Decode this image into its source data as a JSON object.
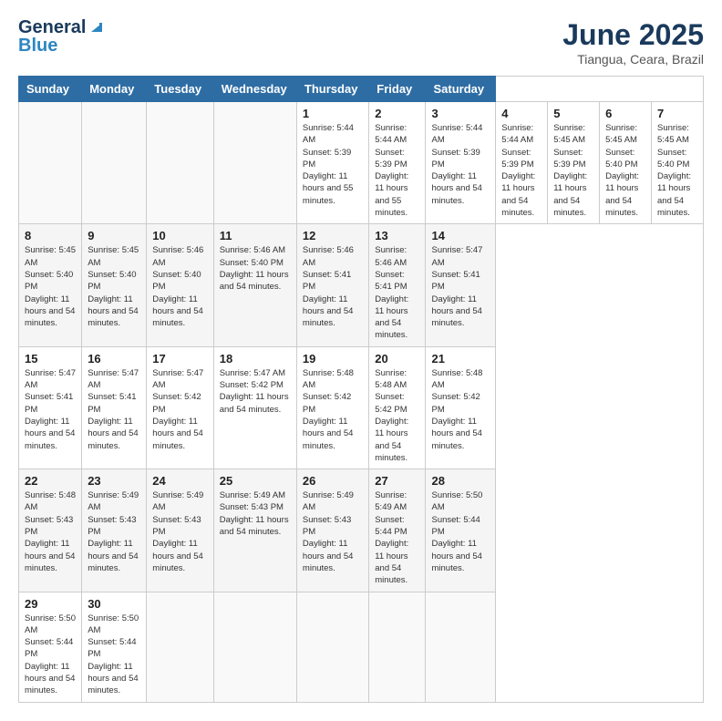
{
  "header": {
    "logo_general": "General",
    "logo_blue": "Blue",
    "month_title": "June 2025",
    "location": "Tiangua, Ceara, Brazil"
  },
  "calendar": {
    "days_of_week": [
      "Sunday",
      "Monday",
      "Tuesday",
      "Wednesday",
      "Thursday",
      "Friday",
      "Saturday"
    ],
    "weeks": [
      [
        null,
        null,
        null,
        null,
        {
          "day": "1",
          "sunrise": "5:44 AM",
          "sunset": "5:39 PM",
          "daylight": "11 hours and 55 minutes."
        },
        {
          "day": "2",
          "sunrise": "5:44 AM",
          "sunset": "5:39 PM",
          "daylight": "11 hours and 55 minutes."
        },
        {
          "day": "3",
          "sunrise": "5:44 AM",
          "sunset": "5:39 PM",
          "daylight": "11 hours and 54 minutes."
        },
        {
          "day": "4",
          "sunrise": "5:44 AM",
          "sunset": "5:39 PM",
          "daylight": "11 hours and 54 minutes."
        },
        {
          "day": "5",
          "sunrise": "5:45 AM",
          "sunset": "5:39 PM",
          "daylight": "11 hours and 54 minutes."
        },
        {
          "day": "6",
          "sunrise": "5:45 AM",
          "sunset": "5:40 PM",
          "daylight": "11 hours and 54 minutes."
        },
        {
          "day": "7",
          "sunrise": "5:45 AM",
          "sunset": "5:40 PM",
          "daylight": "11 hours and 54 minutes."
        }
      ],
      [
        {
          "day": "8",
          "sunrise": "5:45 AM",
          "sunset": "5:40 PM",
          "daylight": "11 hours and 54 minutes."
        },
        {
          "day": "9",
          "sunrise": "5:45 AM",
          "sunset": "5:40 PM",
          "daylight": "11 hours and 54 minutes."
        },
        {
          "day": "10",
          "sunrise": "5:46 AM",
          "sunset": "5:40 PM",
          "daylight": "11 hours and 54 minutes."
        },
        {
          "day": "11",
          "sunrise": "5:46 AM",
          "sunset": "5:40 PM",
          "daylight": "11 hours and 54 minutes."
        },
        {
          "day": "12",
          "sunrise": "5:46 AM",
          "sunset": "5:41 PM",
          "daylight": "11 hours and 54 minutes."
        },
        {
          "day": "13",
          "sunrise": "5:46 AM",
          "sunset": "5:41 PM",
          "daylight": "11 hours and 54 minutes."
        },
        {
          "day": "14",
          "sunrise": "5:47 AM",
          "sunset": "5:41 PM",
          "daylight": "11 hours and 54 minutes."
        }
      ],
      [
        {
          "day": "15",
          "sunrise": "5:47 AM",
          "sunset": "5:41 PM",
          "daylight": "11 hours and 54 minutes."
        },
        {
          "day": "16",
          "sunrise": "5:47 AM",
          "sunset": "5:41 PM",
          "daylight": "11 hours and 54 minutes."
        },
        {
          "day": "17",
          "sunrise": "5:47 AM",
          "sunset": "5:42 PM",
          "daylight": "11 hours and 54 minutes."
        },
        {
          "day": "18",
          "sunrise": "5:47 AM",
          "sunset": "5:42 PM",
          "daylight": "11 hours and 54 minutes."
        },
        {
          "day": "19",
          "sunrise": "5:48 AM",
          "sunset": "5:42 PM",
          "daylight": "11 hours and 54 minutes."
        },
        {
          "day": "20",
          "sunrise": "5:48 AM",
          "sunset": "5:42 PM",
          "daylight": "11 hours and 54 minutes."
        },
        {
          "day": "21",
          "sunrise": "5:48 AM",
          "sunset": "5:42 PM",
          "daylight": "11 hours and 54 minutes."
        }
      ],
      [
        {
          "day": "22",
          "sunrise": "5:48 AM",
          "sunset": "5:43 PM",
          "daylight": "11 hours and 54 minutes."
        },
        {
          "day": "23",
          "sunrise": "5:49 AM",
          "sunset": "5:43 PM",
          "daylight": "11 hours and 54 minutes."
        },
        {
          "day": "24",
          "sunrise": "5:49 AM",
          "sunset": "5:43 PM",
          "daylight": "11 hours and 54 minutes."
        },
        {
          "day": "25",
          "sunrise": "5:49 AM",
          "sunset": "5:43 PM",
          "daylight": "11 hours and 54 minutes."
        },
        {
          "day": "26",
          "sunrise": "5:49 AM",
          "sunset": "5:43 PM",
          "daylight": "11 hours and 54 minutes."
        },
        {
          "day": "27",
          "sunrise": "5:49 AM",
          "sunset": "5:44 PM",
          "daylight": "11 hours and 54 minutes."
        },
        {
          "day": "28",
          "sunrise": "5:50 AM",
          "sunset": "5:44 PM",
          "daylight": "11 hours and 54 minutes."
        }
      ],
      [
        {
          "day": "29",
          "sunrise": "5:50 AM",
          "sunset": "5:44 PM",
          "daylight": "11 hours and 54 minutes."
        },
        {
          "day": "30",
          "sunrise": "5:50 AM",
          "sunset": "5:44 PM",
          "daylight": "11 hours and 54 minutes."
        },
        null,
        null,
        null,
        null,
        null
      ]
    ]
  }
}
